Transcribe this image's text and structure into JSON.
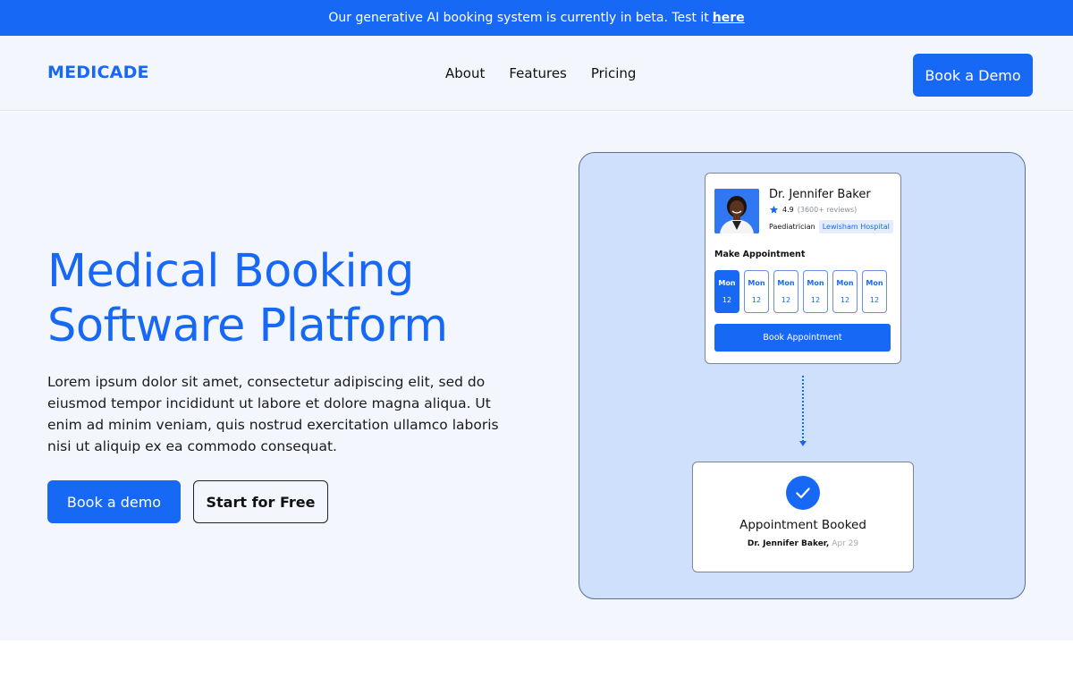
{
  "banner": {
    "text": "Our generative AI booking system is currently in beta. Test it",
    "link": "here"
  },
  "nav": {
    "logo": "MEDICADE",
    "links": [
      "About",
      "Features",
      "Pricing"
    ],
    "cta": "Book a Demo"
  },
  "hero": {
    "title": "Medical Booking Software Platform",
    "description": "Lorem ipsum dolor sit amet, consectetur adipiscing elit, sed do eiusmod tempor incididunt ut labore et dolore magna aliqua. Ut enim ad minim veniam, quis nostrud exercitation ullamco laboris nisi ut aliquip ex ea commodo consequat.",
    "primary_button": "Book a demo",
    "secondary_button": "Start for Free"
  },
  "booking_card": {
    "doctor_name": "Dr. Jennifer Baker",
    "rating": "4.9",
    "reviews": "(3600+ reviews)",
    "specialty": "Paediatrician",
    "hospital": "Lewisham Hospital",
    "make_appointment_label": "Make Appointment",
    "days": [
      {
        "day": "Mon",
        "date": "12"
      },
      {
        "day": "Mon",
        "date": "12"
      },
      {
        "day": "Mon",
        "date": "12"
      },
      {
        "day": "Mon",
        "date": "12"
      },
      {
        "day": "Mon",
        "date": "12"
      },
      {
        "day": "Mon",
        "date": "12"
      }
    ],
    "book_button": "Book Appointment"
  },
  "confirmation": {
    "title": "Appointment Booked",
    "doctor": "Dr. Jennifer Baker,",
    "date": "Apr 29"
  },
  "colors": {
    "accent": "#1768f5",
    "hero_background": "#f3f7fd",
    "illustration_background": "#cfe0fd"
  }
}
